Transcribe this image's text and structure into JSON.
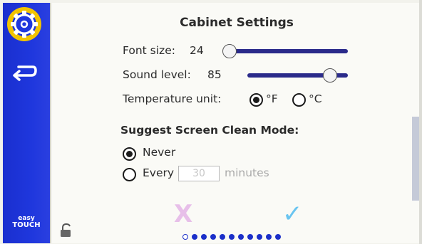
{
  "title": "Cabinet Settings",
  "font_size": {
    "label": "Font size:",
    "value": "24",
    "slider_fraction": 0.0
  },
  "sound_level": {
    "label": "Sound level:",
    "value": "85",
    "slider_fraction": 0.85
  },
  "temperature": {
    "label": "Temperature unit:",
    "options": [
      "°F",
      "°C"
    ],
    "selected": "°F"
  },
  "clean_mode": {
    "heading": "Suggest Screen Clean Mode:",
    "never_label": "Never",
    "every_label": "Every",
    "minutes_value": "30",
    "minutes_label": "minutes",
    "selected": "Never"
  },
  "actions": {
    "cancel": "X",
    "confirm": "✓"
  },
  "sidebar": {
    "brand_top": "easy",
    "brand_bottom": "TOUCH"
  },
  "pager": {
    "total": 11,
    "current": 1
  },
  "colors": {
    "sidebar": "#1f37dd",
    "cancel": "#e7bfe9",
    "confirm": "#69c4f0",
    "gear_ring": "#f2c400"
  },
  "icons": [
    "gear-icon",
    "back-arrow-icon",
    "unlock-icon"
  ]
}
